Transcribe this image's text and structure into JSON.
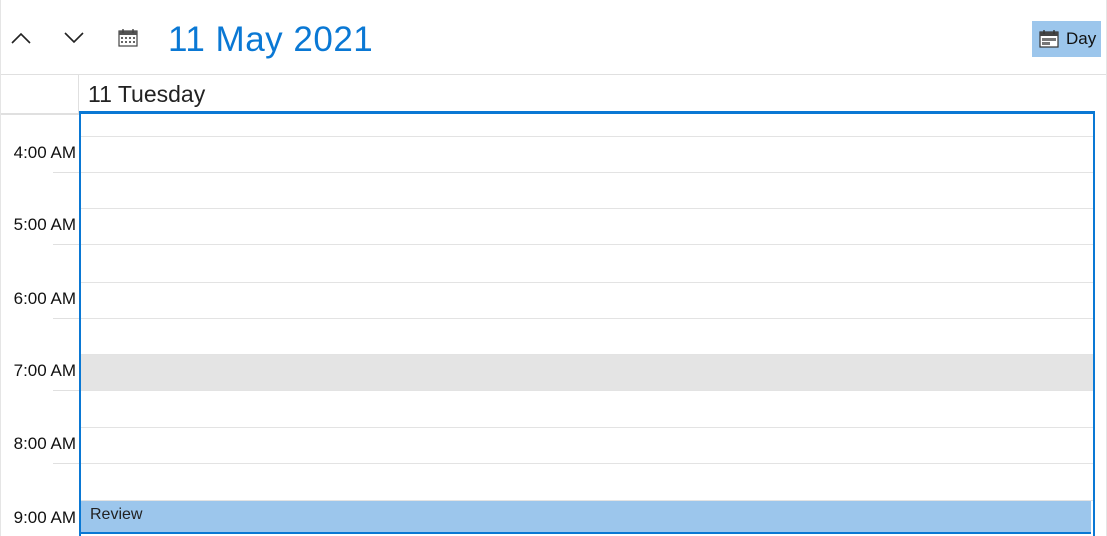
{
  "header": {
    "title": "11 May 2021",
    "prev_icon": "chevron-up-icon",
    "next_icon": "chevron-down-icon",
    "calendar_icon": "calendar-icon",
    "view_button": {
      "label": "Day",
      "icon": "calendar-day-icon",
      "background": "#9cc6ec"
    }
  },
  "day_header": {
    "label": "11 Tuesday",
    "accent": "#0a78d4"
  },
  "time_slots": [
    {
      "label": "4:00 AM"
    },
    {
      "label": "5:00 AM"
    },
    {
      "label": "6:00 AM"
    },
    {
      "label": "7:00 AM"
    },
    {
      "label": "8:00 AM"
    },
    {
      "label": "9:00 AM"
    }
  ],
  "appointments": [
    {
      "subject": "Review",
      "color": "#9cc6ec"
    }
  ],
  "colors": {
    "accent": "#0a78d4",
    "slot_highlight": "#e4e4e4",
    "gridline": "#e3e3e3"
  }
}
